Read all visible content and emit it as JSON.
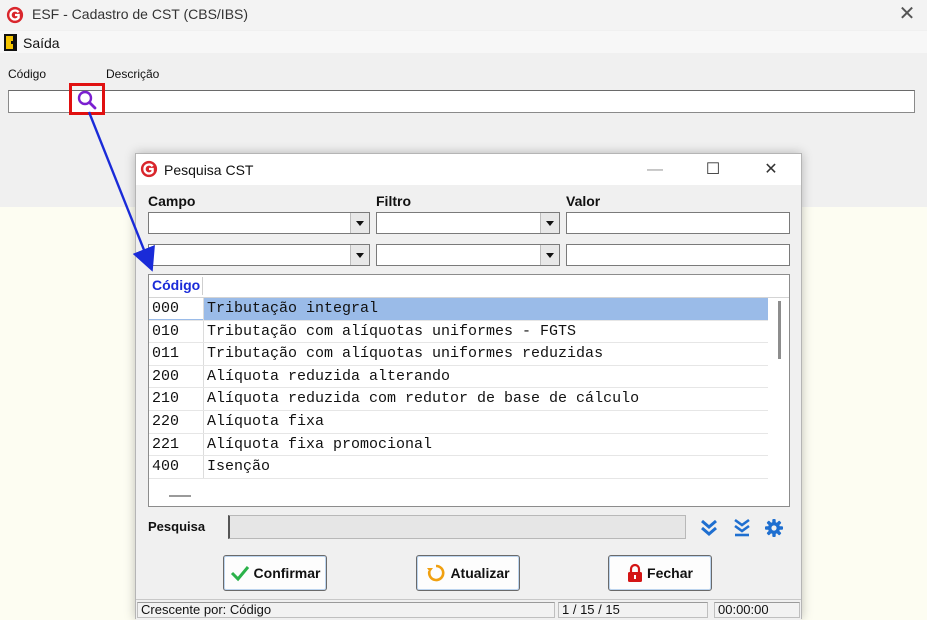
{
  "main_window": {
    "title": "ESF - Cadastro de CST (CBS/IBS)",
    "menu_exit": "Saída",
    "label_codigo": "Código",
    "label_descricao": "Descrição",
    "codigo_value": ""
  },
  "dialog": {
    "title": "Pesquisa CST",
    "minimize": "—",
    "maximize": "☐",
    "close": "✕",
    "col_campo": "Campo",
    "col_filtro": "Filtro",
    "col_valor": "Valor",
    "grid_header_codigo": "Código",
    "rows": [
      {
        "codigo": "000",
        "descricao": "Tributação integral"
      },
      {
        "codigo": "010",
        "descricao": "Tributação com alíquotas uniformes - FGTS"
      },
      {
        "codigo": "011",
        "descricao": "Tributação com alíquotas uniformes reduzidas"
      },
      {
        "codigo": "200",
        "descricao": "Alíquota reduzida alterando"
      },
      {
        "codigo": "210",
        "descricao": "Alíquota reduzida com redutor de base de cálculo"
      },
      {
        "codigo": "220",
        "descricao": "Alíquota fixa"
      },
      {
        "codigo": "221",
        "descricao": "Alíquota fixa promocional"
      },
      {
        "codigo": "400",
        "descricao": "Isenção"
      }
    ],
    "selected_row": 0,
    "label_pesquisa": "Pesquisa",
    "btn_confirmar": "Confirmar",
    "btn_atualizar": "Atualizar",
    "btn_fechar": "Fechar",
    "status_order": "Crescente por: Código",
    "status_count": "1 / 15 / 15",
    "status_time": "00:00:00"
  },
  "colors": {
    "highlight_red": "#e01010",
    "arrow_blue": "#1a2bd8",
    "selection": "#9abbe8",
    "logo_red": "#d9262c"
  }
}
